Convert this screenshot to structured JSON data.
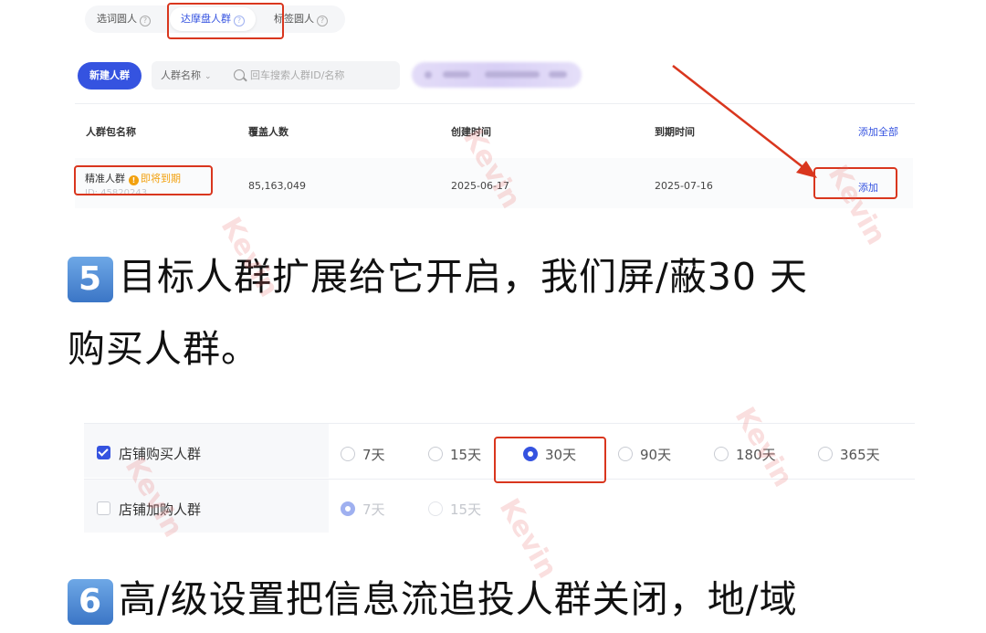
{
  "tabs": [
    {
      "label": "选词圆人",
      "active": false
    },
    {
      "label": "达摩盘人群",
      "active": true
    },
    {
      "label": "标签圆人",
      "active": false
    }
  ],
  "help_glyph": "?",
  "toolbar": {
    "new_button": "新建人群",
    "filter_select": "人群名称",
    "search_placeholder": "回车搜索人群ID/名称"
  },
  "table": {
    "headers": [
      "人群包名称",
      "覆盖人数",
      "创建时间",
      "到期时间"
    ],
    "add_all": "添加全部",
    "rows": [
      {
        "name": "精准人群",
        "warning_glyph": "!",
        "warning": "即将到期",
        "id": "ID: 45820243",
        "coverage": "85,163,049",
        "created": "2025-06-17",
        "expires": "2025-07-16",
        "action": "添加"
      }
    ]
  },
  "step5": {
    "badge": "5",
    "line1": "目标人群扩展给它开启，我们屏/蔽30 天",
    "line2": "购买人群。"
  },
  "settings": {
    "rows": [
      {
        "label": "店铺购买人群",
        "checked": true,
        "options": [
          "7天",
          "15天",
          "30天",
          "90天",
          "180天",
          "365天"
        ],
        "selected": "30天"
      },
      {
        "label": "店铺加购人群",
        "checked": false,
        "options": [
          "7天",
          "15天"
        ],
        "selected": "7天"
      }
    ]
  },
  "step6": {
    "badge": "6",
    "line1": "高/级设置把信息流追投人群关闭，地/域"
  },
  "watermark": "Kevin",
  "colors": {
    "accent": "#3553e0",
    "highlight_box": "#d9361e",
    "warning": "#f2a10f"
  }
}
